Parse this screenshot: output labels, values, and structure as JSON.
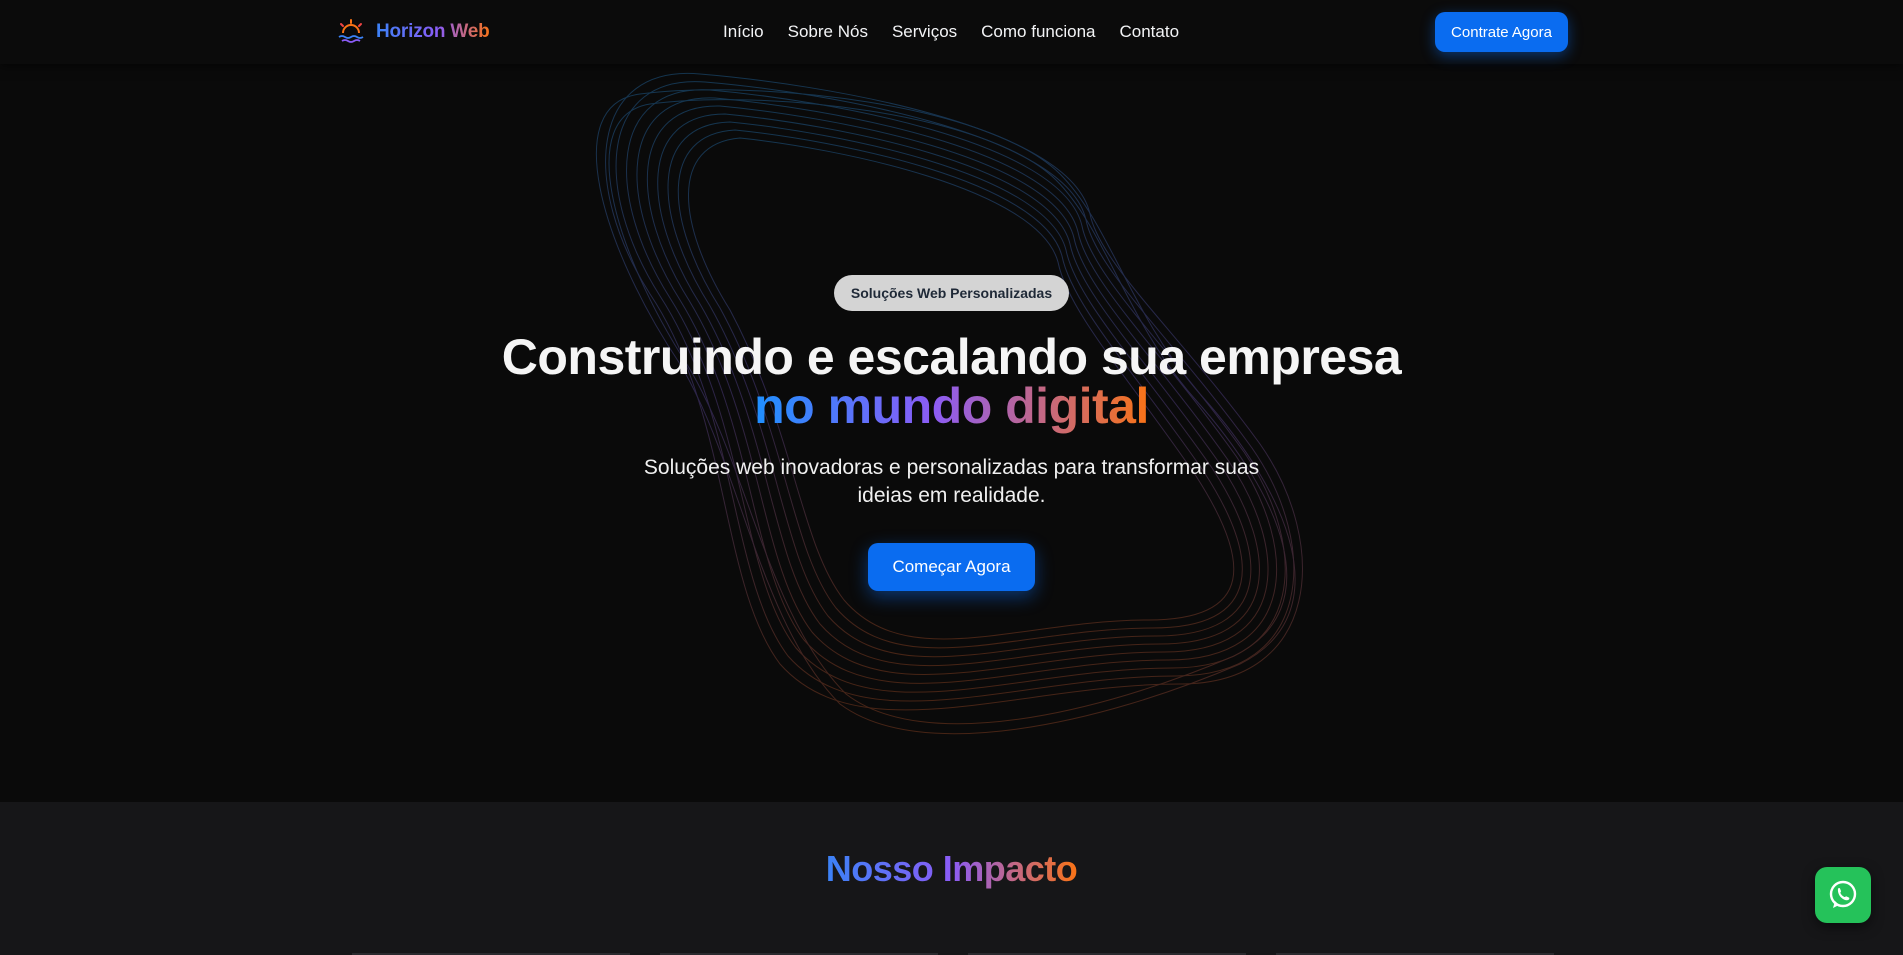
{
  "header": {
    "brand_name": "Horizon Web",
    "nav": [
      {
        "label": "Início"
      },
      {
        "label": "Sobre Nós"
      },
      {
        "label": "Serviços"
      },
      {
        "label": "Como funciona"
      },
      {
        "label": "Contato"
      }
    ],
    "cta_label": "Contrate Agora"
  },
  "hero": {
    "badge": "Soluções Web Personalizadas",
    "headline": "Construindo e escalando sua empresa",
    "headline_accent": "no mundo digital",
    "subtitle": "Soluções web inovadoras e personalizadas para transformar suas ideias em realidade.",
    "cta_label": "Começar Agora"
  },
  "impact": {
    "title": "Nosso Impacto"
  },
  "floating": {
    "icon": "whatsapp-icon"
  },
  "colors": {
    "background": "#0a0a0a",
    "section_background": "#161618",
    "accent_blue": "#0a6cf0",
    "gradient_start": "#3b82f6",
    "gradient_mid": "#8b5cf6",
    "gradient_end": "#f97316",
    "badge_background": "#d4d4d4",
    "whatsapp_green": "#25c25a"
  }
}
